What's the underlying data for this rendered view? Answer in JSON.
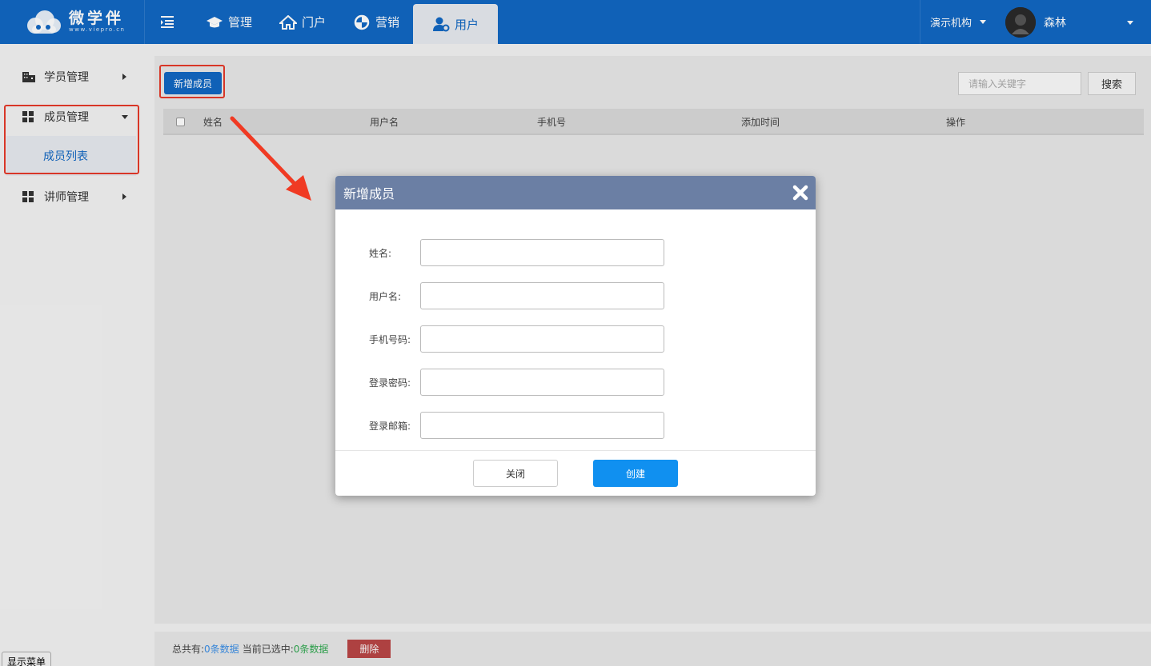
{
  "header": {
    "logo_text": "微学伴",
    "logo_url_text": "www.viepro.cn",
    "nav": [
      {
        "label": "管理",
        "icon": "graduation-cap-icon"
      },
      {
        "label": "门户",
        "icon": "home-icon"
      },
      {
        "label": "营销",
        "icon": "marketing-icon"
      },
      {
        "label": "用户",
        "icon": "user-gear-icon",
        "active": true
      }
    ],
    "org_select": "演示机构",
    "user_name": "森林"
  },
  "sidebar": {
    "items": [
      {
        "label": "学员管理",
        "icon": "building-icon"
      },
      {
        "label": "成员管理",
        "icon": "grid-icon",
        "expanded": true
      },
      {
        "label": "讲师管理",
        "icon": "grid-icon"
      }
    ],
    "sub_item": "成员列表",
    "show_menu": "显示菜单"
  },
  "toolbar": {
    "add_label": "新增成员",
    "search_placeholder": "请输入关键字",
    "search_label": "搜索"
  },
  "table": {
    "columns": [
      "姓名",
      "用户名",
      "手机号",
      "添加时间",
      "操作"
    ]
  },
  "footer": {
    "total_label": "总共有:",
    "total_count": "0条数据",
    "selected_label": "当前已选中:",
    "selected_count": "0条数据",
    "delete_label": "删除"
  },
  "modal": {
    "title": "新增成员",
    "fields": [
      {
        "label": "姓名:",
        "value": ""
      },
      {
        "label": "用户名:",
        "value": ""
      },
      {
        "label": "手机号码:",
        "value": ""
      },
      {
        "label": "登录密码:",
        "value": ""
      },
      {
        "label": "登录邮箱:",
        "value": ""
      }
    ],
    "close_label": "关闭",
    "create_label": "创建"
  },
  "colors": {
    "primary": "#1268c3",
    "modal_header": "#6b7fa4",
    "create_button": "#1090f0",
    "highlight": "#e63a2a",
    "delete": "#b12a2a"
  }
}
